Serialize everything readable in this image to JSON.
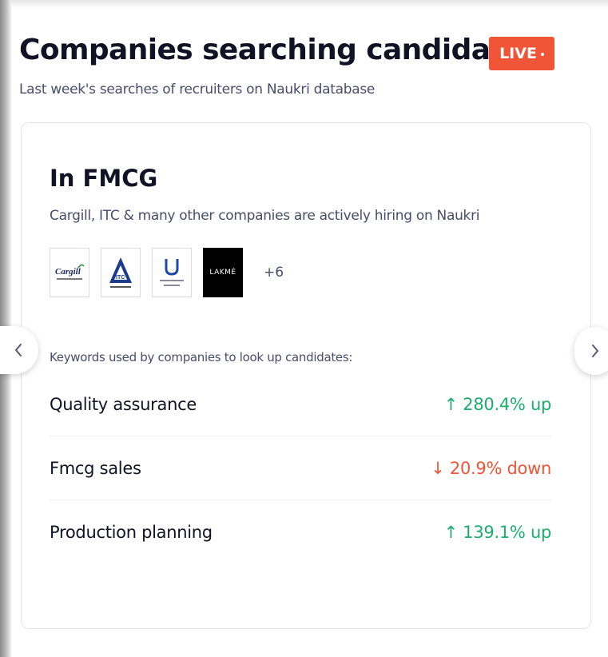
{
  "header": {
    "title": "Companies searching candidates",
    "live_badge": "LIVE",
    "subtitle": "Last week's searches of recruiters on Naukri database"
  },
  "card": {
    "industry_title": "In FMCG",
    "description": "Cargill, ITC & many other companies are actively hiring on Naukri",
    "logos": [
      {
        "name": "Cargill",
        "icon": "cargill-logo"
      },
      {
        "name": "ITC",
        "icon": "itc-logo"
      },
      {
        "name": "Hindustan Unilever Limited",
        "icon": "unilever-logo"
      },
      {
        "name": "LAKMÉ",
        "icon": "lakme-logo"
      }
    ],
    "more_count": "+6",
    "keywords_label": "Keywords used by companies to look up candidates:",
    "keywords": [
      {
        "name": "Quality assurance",
        "change": "↑ 280.4% up",
        "direction": "up"
      },
      {
        "name": "Fmcg sales",
        "change": "↓ 20.9% down",
        "direction": "down"
      },
      {
        "name": "Production planning",
        "change": "↑ 139.1% up",
        "direction": "up"
      }
    ]
  },
  "navigation": {
    "prev_icon": "chevron-left-icon",
    "next_icon": "chevron-right-icon"
  },
  "colors": {
    "live_badge": "#f05537",
    "up": "#1dae6d",
    "down": "#f05537",
    "title": "#121224",
    "muted": "#474d6a"
  }
}
